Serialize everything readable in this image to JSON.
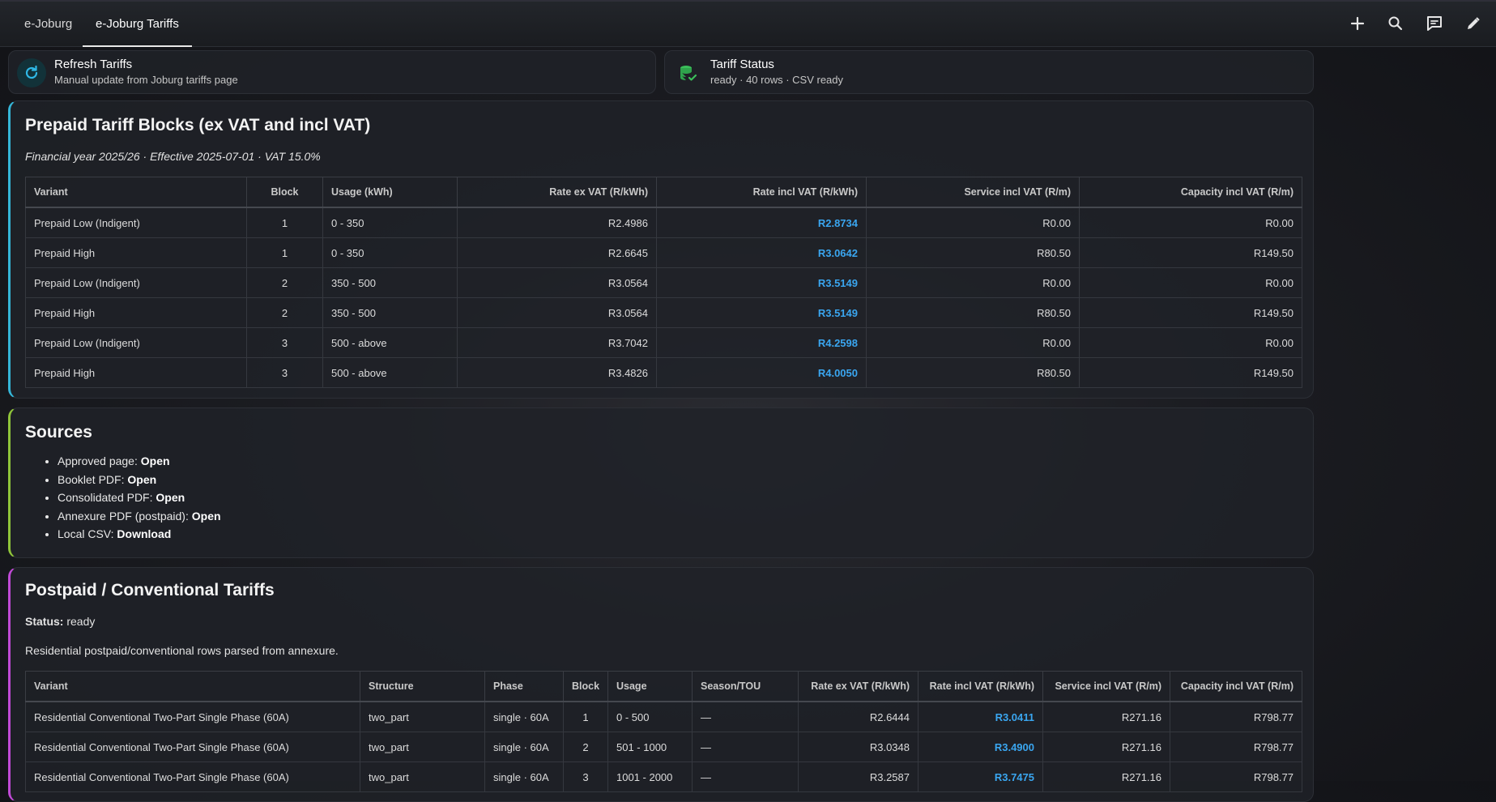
{
  "tabs": [
    {
      "label": "e-Joburg"
    },
    {
      "label": "e-Joburg Tariffs"
    }
  ],
  "toolbar": {
    "icons": [
      "plus-icon",
      "search-icon",
      "chat-icon",
      "pencil-icon"
    ]
  },
  "refresh_card": {
    "title": "Refresh Tariffs",
    "subtitle": "Manual update from Joburg tariffs page",
    "icon": "refresh-icon"
  },
  "status_card": {
    "title": "Tariff Status",
    "subtitle": "ready · 40 rows · CSV ready",
    "icon": "database-check-icon"
  },
  "prepaid": {
    "title": "Prepaid Tariff Blocks (ex VAT and incl VAT)",
    "meta": "Financial year 2025/26 · Effective 2025-07-01 · VAT 15.0%",
    "columns": [
      "Variant",
      "Block",
      "Usage (kWh)",
      "Rate ex VAT (R/kWh)",
      "Rate incl VAT (R/kWh)",
      "Service incl VAT (R/m)",
      "Capacity incl VAT (R/m)"
    ],
    "rows": [
      [
        "Prepaid Low (Indigent)",
        "1",
        "0 - 350",
        "R2.4986",
        "R2.8734",
        "R0.00",
        "R0.00"
      ],
      [
        "Prepaid High",
        "1",
        "0 - 350",
        "R2.6645",
        "R3.0642",
        "R80.50",
        "R149.50"
      ],
      [
        "Prepaid Low (Indigent)",
        "2",
        "350 - 500",
        "R3.0564",
        "R3.5149",
        "R0.00",
        "R0.00"
      ],
      [
        "Prepaid High",
        "2",
        "350 - 500",
        "R3.0564",
        "R3.5149",
        "R80.50",
        "R149.50"
      ],
      [
        "Prepaid Low (Indigent)",
        "3",
        "500 - above",
        "R3.7042",
        "R4.2598",
        "R0.00",
        "R0.00"
      ],
      [
        "Prepaid High",
        "3",
        "500 - above",
        "R3.4826",
        "R4.0050",
        "R80.50",
        "R149.50"
      ]
    ]
  },
  "sources": {
    "title": "Sources",
    "items": [
      {
        "label": "Approved page:",
        "link": "Open"
      },
      {
        "label": "Booklet PDF:",
        "link": "Open"
      },
      {
        "label": "Consolidated PDF:",
        "link": "Open"
      },
      {
        "label": "Annexure PDF (postpaid):",
        "link": "Open"
      },
      {
        "label": "Local CSV:",
        "link": "Download"
      }
    ]
  },
  "postpaid": {
    "title": "Postpaid / Conventional Tariffs",
    "status_label": "Status:",
    "status_value": "ready",
    "description": "Residential postpaid/conventional rows parsed from annexure.",
    "columns": [
      "Variant",
      "Structure",
      "Phase",
      "Block",
      "Usage",
      "Season/TOU",
      "Rate ex VAT (R/kWh)",
      "Rate incl VAT (R/kWh)",
      "Service incl VAT (R/m)",
      "Capacity incl VAT (R/m)"
    ],
    "rows": [
      [
        "Residential Conventional Two-Part Single Phase (60A)",
        "two_part",
        "single · 60A",
        "1",
        "0 - 500",
        "—",
        "R2.6444",
        "R3.0411",
        "R271.16",
        "R798.77"
      ],
      [
        "Residential Conventional Two-Part Single Phase (60A)",
        "two_part",
        "single · 60A",
        "2",
        "501 - 1000",
        "—",
        "R3.0348",
        "R3.4900",
        "R271.16",
        "R798.77"
      ],
      [
        "Residential Conventional Two-Part Single Phase (60A)",
        "two_part",
        "single · 60A",
        "3",
        "1001 - 2000",
        "—",
        "R3.2587",
        "R3.7475",
        "R271.16",
        "R798.77"
      ]
    ]
  }
}
